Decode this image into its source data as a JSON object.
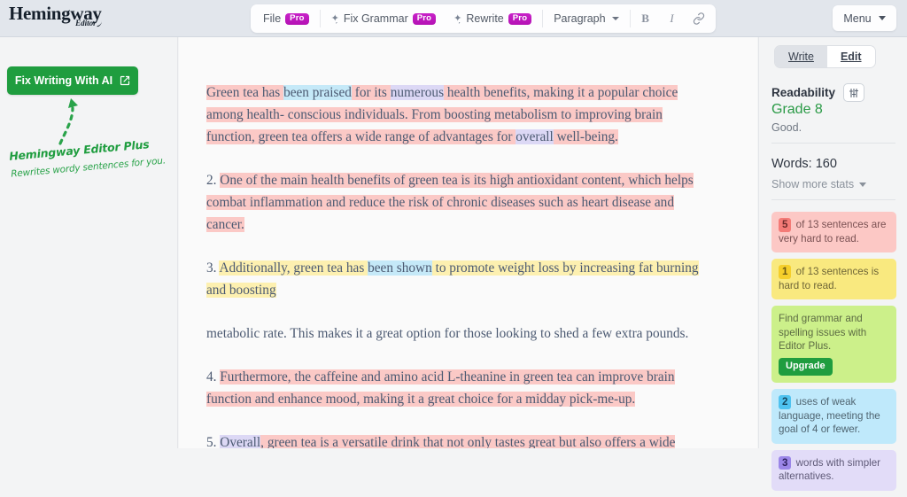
{
  "app": {
    "logo_main": "Hemingway",
    "logo_sub": "Editor"
  },
  "toolbar": {
    "file_label": "File",
    "file_badge": "Pro",
    "fix_grammar_label": "Fix Grammar",
    "fix_grammar_badge": "Pro",
    "rewrite_label": "Rewrite",
    "rewrite_badge": "Pro",
    "paragraph_label": "Paragraph",
    "bold_label": "B",
    "italic_label": "I",
    "link_icon": "link-icon",
    "sparkle_icon": "sparkle-icon",
    "menu_label": "Menu"
  },
  "left_panel": {
    "ai_button_label": "Fix Writing With AI",
    "ai_button_icon": "external-link-icon",
    "arrow_icon": "dashed-curved-arrow-icon",
    "promo_title": "Hemingway Editor Plus",
    "promo_subtitle": "Rewrites wordy sentences for you."
  },
  "document": {
    "paragraphs": [
      {
        "id": "p1",
        "runs": [
          {
            "text": "Green tea has ",
            "style": "pink"
          },
          {
            "text": "been praised",
            "style": "blue"
          },
          {
            "text": " for its ",
            "style": "pink"
          },
          {
            "text": "numerous",
            "style": "purple"
          },
          {
            "text": " health benefits, making it a popular choice among health- conscious individuals. From boosting metabolism to improving brain function, green tea offers a wide range of advantages for ",
            "style": "pink"
          },
          {
            "text": "overall",
            "style": "purple"
          },
          {
            "text": " well-being.",
            "style": "pink"
          }
        ]
      },
      {
        "id": "p2",
        "runs": [
          {
            "text": "2. ",
            "style": "none"
          },
          {
            "text": "One of the main health benefits of green tea is its high antioxidant content, which helps combat inflammation and reduce the risk of chronic diseases such as heart disease and cancer.",
            "style": "pink"
          }
        ]
      },
      {
        "id": "p3",
        "runs": [
          {
            "text": "3. ",
            "style": "none"
          },
          {
            "text": "Additionally, green tea has ",
            "style": "yellow"
          },
          {
            "text": "been shown",
            "style": "blue"
          },
          {
            "text": " to promote weight loss by increasing fat burning and boosting",
            "style": "yellow"
          }
        ]
      },
      {
        "id": "p4",
        "runs": [
          {
            "text": "metabolic rate. This makes it a great option for those looking to shed a few extra pounds.",
            "style": "none"
          }
        ]
      },
      {
        "id": "p5",
        "runs": [
          {
            "text": "4. ",
            "style": "none"
          },
          {
            "text": "Furthermore, the caffeine and amino acid L-theanine in green tea can improve brain function and enhance mood, making it a great choice for a midday pick-me-up.",
            "style": "pink"
          }
        ]
      },
      {
        "id": "p6",
        "runs": [
          {
            "text": "5. ",
            "style": "none"
          },
          {
            "text": "Overall",
            "style": "purple"
          },
          {
            "text": ", green tea is a versatile drink that not only tastes great but also offers a wide range of health benefits that can improve both physical and mental well-being.",
            "style": "pink"
          }
        ]
      }
    ]
  },
  "sidebar": {
    "mode_write": "Write",
    "mode_edit": "Edit",
    "active_mode": "Edit",
    "readability_label": "Readability",
    "readability_settings_icon": "sliders-icon",
    "grade": "Grade 8",
    "grade_note": "Good.",
    "words": "Words: 160",
    "show_more_stats": "Show more stats",
    "cards": [
      {
        "id": "very-hard",
        "variant": "pink",
        "count": "5",
        "text": " of 13 sentences are very hard to read."
      },
      {
        "id": "hard",
        "variant": "yellow",
        "count": "1",
        "text": " of 13 sentences is hard to read."
      },
      {
        "id": "grammar",
        "variant": "green",
        "count": "",
        "text": "Find grammar and spelling issues with Editor Plus.",
        "button": "Upgrade"
      },
      {
        "id": "weak-language",
        "variant": "blue",
        "count": "2",
        "text": " uses of weak language, meeting the goal of 4 or fewer."
      },
      {
        "id": "simpler-alternatives",
        "variant": "purple",
        "count": "3",
        "text": " words with simpler alternatives."
      }
    ]
  },
  "colors": {
    "accent_green": "#1f9d3f",
    "pro_purple": "#c720c7",
    "very_hard": "#fbc9c6",
    "hard": "#fdf0b0",
    "weak": "#c5e9f8",
    "simpler": "#dcd8f5",
    "grade_green": "#2a9a46"
  }
}
